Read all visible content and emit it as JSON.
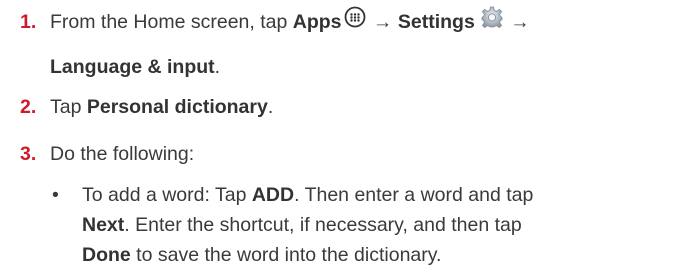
{
  "steps": [
    {
      "number": "1.",
      "text_a": "From the Home screen, tap ",
      "apps": "Apps",
      "arrow1": " → ",
      "settings": "Settings",
      "arrow2": " →",
      "language": "Language & input",
      "period": "."
    },
    {
      "number": "2.",
      "text_a": "Tap ",
      "personal": "Personal dictionary",
      "period": "."
    },
    {
      "number": "3.",
      "text": "Do the following:"
    }
  ],
  "bullet": {
    "symbol": "•",
    "line1_a": "To add a word: Tap ",
    "add": "ADD",
    "line1_b": ". Then enter a word and tap",
    "next": "Next",
    "line2_b": ". Enter the shortcut, if necessary, and then tap",
    "done": "Done",
    "line3_b": " to save the word into the dictionary."
  },
  "icons": {
    "apps": "apps-grid-icon",
    "settings": "settings-gear-icon"
  },
  "colors": {
    "step_number": "#cc1b2b",
    "text": "#3a3a3a"
  }
}
